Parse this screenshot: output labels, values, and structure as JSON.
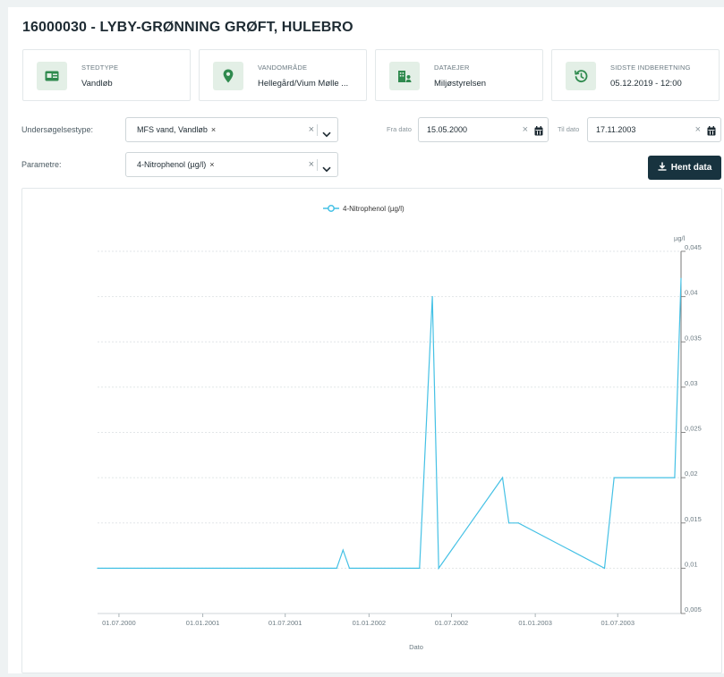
{
  "header": {
    "title": "16000030 - LYBY-GRØNNING GRØFT, HULEBRO"
  },
  "cards": [
    {
      "label": "STEDTYPE",
      "value": "Vandløb",
      "icon": "id-card-icon"
    },
    {
      "label": "VANDOMRÅDE",
      "value": "Hellegård/Vium Mølle ...",
      "icon": "location-pin-icon"
    },
    {
      "label": "DATAEJER",
      "value": "Miljøstyrelsen",
      "icon": "building-user-icon"
    },
    {
      "label": "SIDSTE INDBERETNING",
      "value": "05.12.2019 - 12:00",
      "icon": "history-icon"
    }
  ],
  "filters": {
    "survey_label": "Undersøgelsestype:",
    "survey_chip": "MFS vand, Vandløb",
    "param_label": "Parametre:",
    "param_chip": "4-Nitrophenol (µg/l)",
    "from_label": "Fra dato",
    "from_value": "15.05.2000",
    "to_label": "Til dato",
    "to_value": "17.11.2003",
    "fetch_label": "Hent data",
    "chip_remove": "×",
    "clear_symbol": "×"
  },
  "colors": {
    "accent": "#18333f",
    "series": "#45c1e5",
    "icon_bg": "#e3efe6",
    "icon_fg": "#2f8a4e"
  },
  "chart_data": {
    "type": "line",
    "series": [
      {
        "name": "4-Nitrophenol (µg/l)",
        "x": [
          "2000-05-15",
          "2001-10-22",
          "2001-11-05",
          "2001-11-19",
          "2002-04-22",
          "2002-05-20",
          "2002-06-03",
          "2002-10-21",
          "2002-11-04",
          "2002-11-25",
          "2003-06-02",
          "2003-06-23",
          "2003-11-03",
          "2003-11-17"
        ],
        "values": [
          0.01,
          0.01,
          0.012,
          0.01,
          0.01,
          0.04,
          0.01,
          0.02,
          0.015,
          0.015,
          0.01,
          0.02,
          0.02,
          0.042
        ]
      }
    ],
    "xlabel": "Dato",
    "ylabel": "µg/l",
    "x_ticks": [
      "01.07.2000",
      "01.01.2001",
      "01.07.2001",
      "01.01.2002",
      "01.07.2002",
      "01.01.2003",
      "01.07.2003"
    ],
    "y_ticks": [
      "0,005",
      "0,01",
      "0,015",
      "0,02",
      "0,025",
      "0,03",
      "0,035",
      "0,04",
      "0,045"
    ],
    "ylim": [
      0.005,
      0.045
    ],
    "xlim": [
      "2000-05-15",
      "2003-11-17"
    ],
    "legend": "top-center",
    "grid": true,
    "y_axis_side": "right"
  }
}
